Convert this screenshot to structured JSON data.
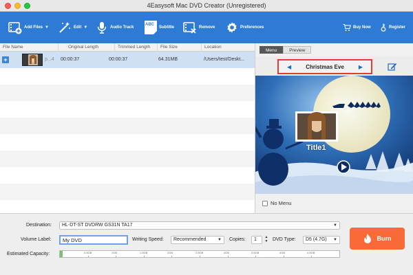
{
  "window": {
    "title": "4Easysoft Mac DVD Creator (Unregistered)"
  },
  "toolbar": {
    "add_files": "Add Files",
    "edit": "Edit",
    "audio_track": "Audio Track",
    "subtitle": "Subtitle",
    "remove": "Remove",
    "preferences": "Preferences",
    "buy_now": "Buy Now",
    "register": "Register",
    "subtitle_icon_text": "ABC"
  },
  "file_list": {
    "columns": [
      "File Name",
      "Original Length",
      "Trimmed Length",
      "File Size",
      "Location"
    ],
    "rows": [
      {
        "name": "p...4",
        "original_length": "00:00:37",
        "trimmed_length": "00:00:37",
        "file_size": "64.31MB",
        "location": "/Users/test/Deskt..."
      }
    ]
  },
  "preview_panel": {
    "tabs": [
      "Menu",
      "Preview"
    ],
    "active_tab": "Menu",
    "menu_title": "Christmas Eve",
    "scene_title": "Title1",
    "no_menu_label": "No Menu",
    "no_menu_checked": false
  },
  "bottom": {
    "destination_label": "Destination:",
    "destination_value": "HL-DT-ST DVDRW  GS31N TA17",
    "volume_label_label": "Volume Label:",
    "volume_label_value": "My DVD",
    "writing_speed_label": "Writing Speed:",
    "writing_speed_value": "Recommended",
    "copies_label": "Copies:",
    "copies_value": "1",
    "dvd_type_label": "DVD Type:",
    "dvd_type_value": "D5 (4.7G)",
    "capacity_label": "Estimated Capacity:",
    "capacity_fill_fraction": 0.01,
    "capacity_ticks": [
      "0.5GB",
      "1GB",
      "1.5GB",
      "2GB",
      "2.5GB",
      "3GB",
      "3.5GB",
      "4GB",
      "4.5GB"
    ],
    "burn_label": "Burn"
  },
  "colors": {
    "toolbar_blue": "#2e7bd6",
    "selected_row": "#cfe0f5",
    "burn_orange": "#fa6a37",
    "highlight_red": "#e23b2f",
    "capacity_green": "#7ec06a"
  },
  "icons": [
    "film-add-icon",
    "magic-wand-icon",
    "microphone-icon",
    "subtitle-abc-icon",
    "film-remove-icon",
    "gear-icon",
    "cart-icon",
    "key-icon",
    "edit-icon",
    "flame-icon",
    "play-icon"
  ]
}
